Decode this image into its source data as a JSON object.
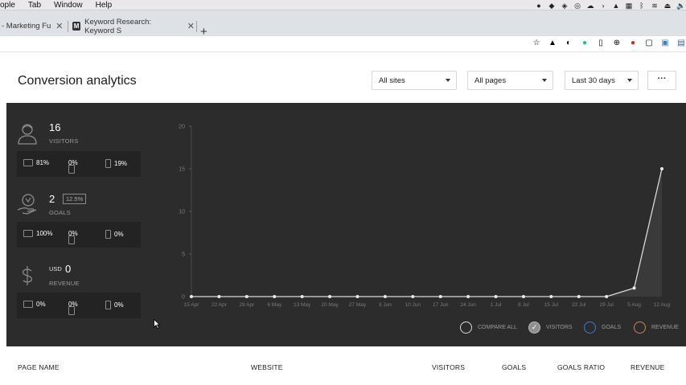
{
  "menubar": {
    "items": [
      "ople",
      "Tab",
      "Window",
      "Help"
    ]
  },
  "tabs": [
    {
      "label": "- Marketing Fu"
    },
    {
      "label": "Keyword Research: Keyword S",
      "favicon": "M"
    }
  ],
  "header": {
    "title": "Conversion analytics",
    "site_select": "All sites",
    "page_select": "All pages",
    "range_select": "Last 30 days",
    "more": "···"
  },
  "metrics": {
    "visitors": {
      "value": "16",
      "label": "VISITORS",
      "devices": [
        "81%",
        "0%",
        "19%"
      ]
    },
    "goals": {
      "value": "2",
      "badge": "12.5%",
      "label": "GOALS",
      "devices": [
        "100%",
        "0%",
        "0%"
      ]
    },
    "revenue": {
      "currency": "USD",
      "value": "0",
      "label": "REVENUE",
      "devices": [
        "0%",
        "0%",
        "0%"
      ]
    }
  },
  "chart_data": {
    "type": "line",
    "x": [
      "15 Apr",
      "22 Apr",
      "29 Apr",
      "6 May",
      "13 May",
      "20 May",
      "27 May",
      "3 Jun",
      "10 Jun",
      "17 Jun",
      "24 Jun",
      "1 Jul",
      "8 Jul",
      "15 Jul",
      "22 Jul",
      "29 Jul",
      "5 Aug",
      "12 Aug"
    ],
    "yticks": [
      0,
      5,
      10,
      15,
      20
    ],
    "ylim": [
      0,
      20
    ],
    "series": [
      {
        "name": "VISITORS",
        "values": [
          0,
          0,
          0,
          0,
          0,
          0,
          0,
          0,
          0,
          0,
          0,
          0,
          0,
          0,
          0,
          0,
          1,
          15
        ]
      }
    ],
    "legend": [
      "COMPARE ALL",
      "VISITORS",
      "GOALS",
      "REVENUE"
    ],
    "colors": {
      "compare": "#d9d9d9",
      "visitors": "#b8b8b8",
      "goals": "#3a7bd5",
      "revenue": "#c9874a"
    }
  },
  "table": {
    "columns": [
      "PAGE NAME",
      "WEBSITE",
      "VISITORS",
      "GOALS",
      "GOALS RATIO",
      "REVENUE"
    ]
  }
}
